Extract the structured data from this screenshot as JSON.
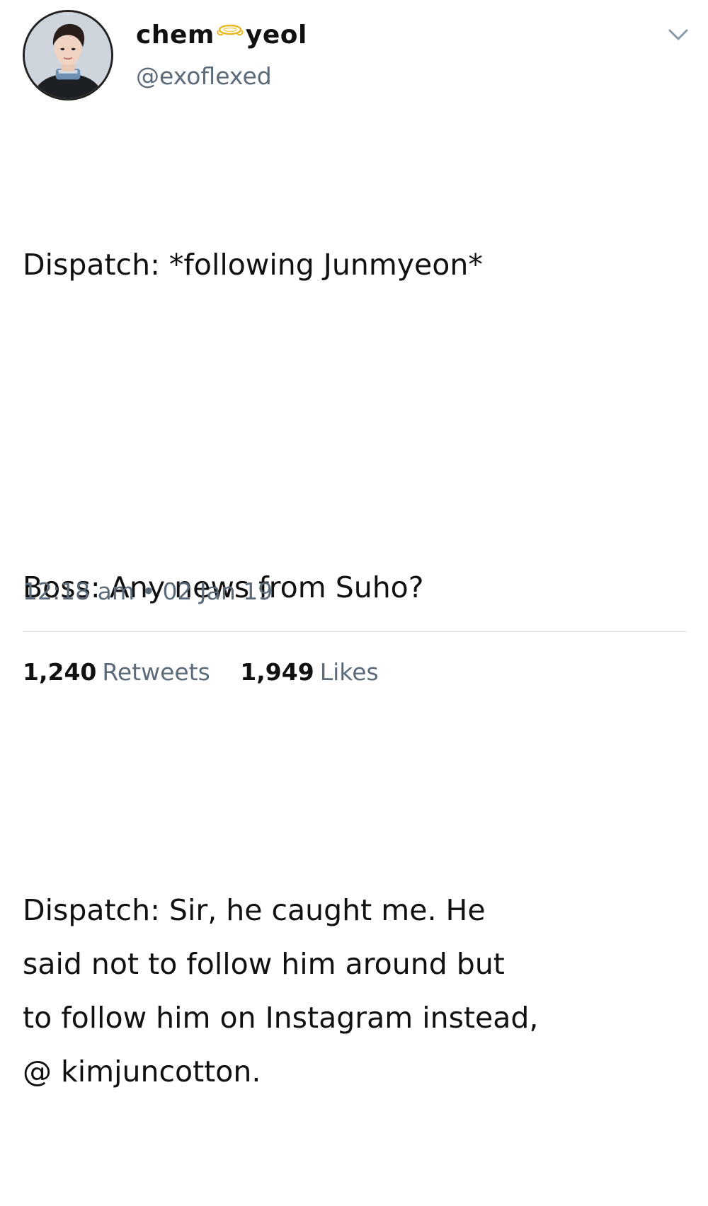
{
  "user": {
    "display_name_first": "chem",
    "display_name_last": "yeol",
    "name_icon": "halo-icon",
    "handle": "@exoflexed",
    "avatar_icon": "avatar"
  },
  "header": {
    "more_icon": "chevron-down-icon"
  },
  "tweet": {
    "paragraphs": [
      "Dispatch: *following Junmyeon*",
      "Boss: Any news from Suho?",
      "Dispatch: Sir, he caught me. He\nsaid not to follow him around but\nto follow him on Instagram instead,\n@ kimjuncotton."
    ],
    "time": "12:18 am",
    "separator": "•",
    "date": "02 Jan 19"
  },
  "stats": {
    "retweets_count": "1,240",
    "retweets_label": "Retweets",
    "likes_count": "1,949",
    "likes_label": "Likes"
  },
  "colors": {
    "text": "#111111",
    "secondary": "#5b6b7a",
    "divider": "#d6dde3",
    "halo": "#e8b923"
  }
}
